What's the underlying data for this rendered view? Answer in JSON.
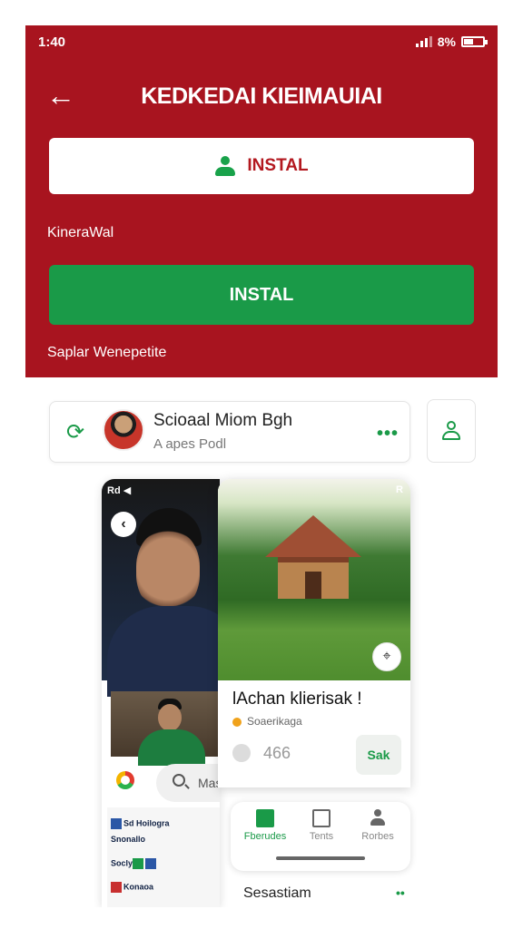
{
  "status_bar": {
    "time": "1:40",
    "battery_text": "8%",
    "battery_level": 0.45
  },
  "header": {
    "title": "KEDKEDAI KIEIMAUIAI",
    "primary_button_label": "INSTAL",
    "section_label": "KineraWal",
    "secondary_button_label": "INSTAL",
    "footer_text": "Saplar Wenepetite"
  },
  "profile_card": {
    "name": "Scioaal Miom Bgh",
    "subtitle": "A apes Podl"
  },
  "left_panel": {
    "status_text": "Rd ◀",
    "search_placeholder": "Mas",
    "news_rows": [
      "Sd Hoilogra",
      "Snonallo",
      "Socly",
      "Konaoa"
    ]
  },
  "center_card": {
    "status_text": "R",
    "title": "lAchan klierisak !",
    "subtitle": "Soaerikaga",
    "count": "466",
    "action_label": "Sak"
  },
  "bottom_nav": {
    "items": [
      {
        "label": "Fberudes",
        "icon": "book-icon",
        "active": true
      },
      {
        "label": "Tents",
        "icon": "mail-icon",
        "active": false
      },
      {
        "label": "Rorbes",
        "icon": "user-icon",
        "active": false
      }
    ]
  },
  "bottom_caption": "Sesastiam",
  "colors": {
    "header_red": "#a8141f",
    "accent_green": "#1a9a48"
  }
}
